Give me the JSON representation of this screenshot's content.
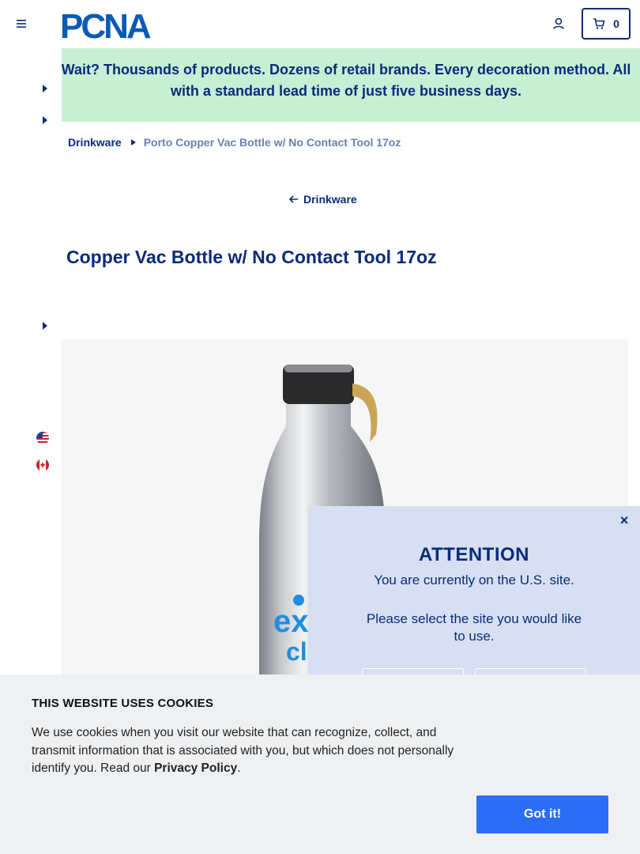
{
  "header": {
    "logo_text": "PCNA",
    "cart_count": "0"
  },
  "promo": {
    "text": "Wait? Thousands of products. Dozens of retail brands. Every decoration method. All with a standard lead time of just five business days."
  },
  "breadcrumb": {
    "parent": "Drinkware",
    "current": "Porto Copper Vac Bottle w/ No Contact Tool 17oz"
  },
  "back_link": "Drinkware",
  "product": {
    "title": "Copper Vac Bottle w/ No Contact Tool 17oz"
  },
  "modal": {
    "close": "×",
    "title": "ATTENTION",
    "line1": "You are currently on the U.S. site.",
    "line2": "Please select the site you would like to use."
  },
  "cookie": {
    "title": "THIS WEBSITE USES COOKIES",
    "body_pre": "We use cookies when you visit our website that can recognize, collect, and transmit information that is associated with you, but which does not personally identify you. Read our ",
    "link": "Privacy Policy",
    "body_post": ".",
    "button": "Got it!"
  },
  "colors": {
    "brand_navy": "#0a2b7a",
    "promo_bg": "#c6efd3",
    "modal_bg": "#d6e0f2",
    "cookie_bg": "#eff0f1",
    "cookie_button": "#2b6df5"
  },
  "icons": [
    "menu-icon",
    "user-icon",
    "cart-icon",
    "chevron-right-icon",
    "arrow-left-icon",
    "us-flag-icon",
    "canada-flag-icon",
    "close-icon"
  ]
}
